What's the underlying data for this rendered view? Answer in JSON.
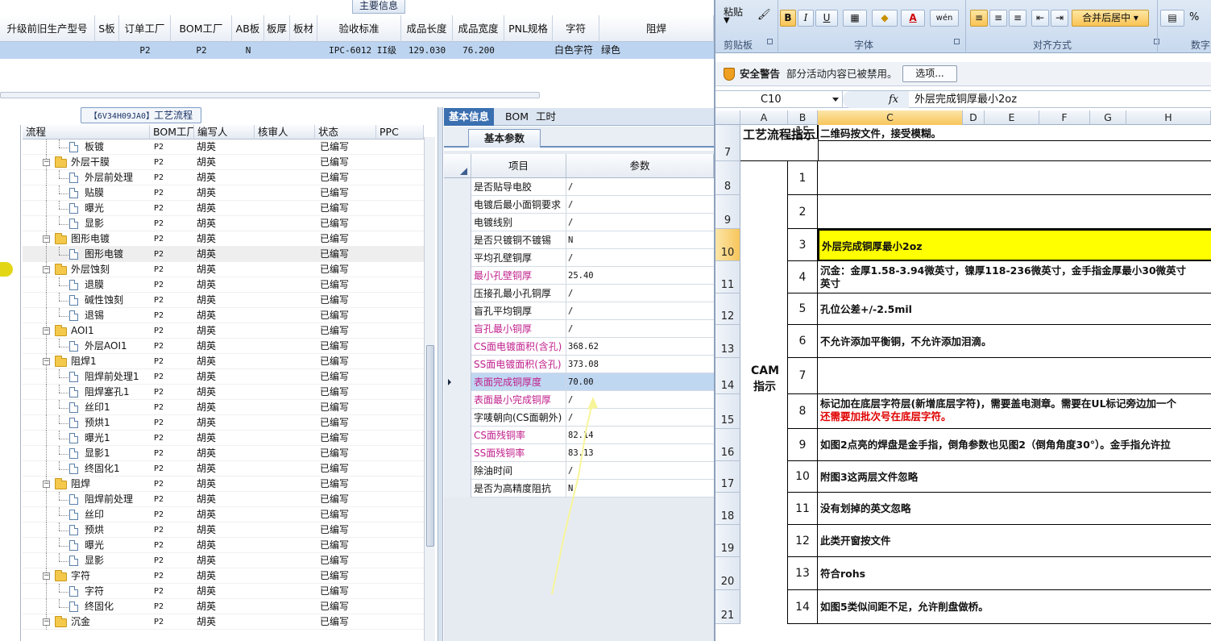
{
  "top_grid": {
    "tab_label": "主要信息",
    "columns": [
      "升级前旧生产型号",
      "S板",
      "订单工厂",
      "BOM工厂",
      "AB板",
      "板厚",
      "板材",
      "验收标准",
      "成品长度",
      "成品宽度",
      "PNL规格",
      "字符",
      "阻焊"
    ],
    "row": [
      "",
      "",
      "P2",
      "P2",
      "N",
      "",
      "",
      "IPC-6012 II级",
      "129.030",
      "76.200",
      "",
      "白色字符",
      "绿色"
    ]
  },
  "process": {
    "title_code": "【6V34H09JA0】",
    "title_text": "工艺流程",
    "columns": [
      "流程",
      "BOM工厂",
      "编写人",
      "核审人",
      "状态",
      "PPC"
    ],
    "rows": [
      {
        "name": "板镀",
        "folder": false,
        "bom": "P2",
        "author": "胡英",
        "status": "已编写"
      },
      {
        "name": "外层干膜",
        "folder": true,
        "bom": "P2",
        "author": "胡英",
        "status": "已编写"
      },
      {
        "name": "外层前处理",
        "folder": false,
        "bom": "P2",
        "author": "胡英",
        "status": "已编写"
      },
      {
        "name": "贴膜",
        "folder": false,
        "bom": "P2",
        "author": "胡英",
        "status": "已编写"
      },
      {
        "name": "曝光",
        "folder": false,
        "bom": "P2",
        "author": "胡英",
        "status": "已编写"
      },
      {
        "name": "显影",
        "folder": false,
        "bom": "P2",
        "author": "胡英",
        "status": "已编写"
      },
      {
        "name": "图形电镀",
        "folder": true,
        "bom": "P2",
        "author": "胡英",
        "status": "已编写"
      },
      {
        "name": "图形电镀",
        "folder": false,
        "bom": "P2",
        "author": "胡英",
        "status": "已编写",
        "selected": true
      },
      {
        "name": "外层蚀刻",
        "folder": true,
        "bom": "P2",
        "author": "胡英",
        "status": "已编写"
      },
      {
        "name": "退膜",
        "folder": false,
        "bom": "P2",
        "author": "胡英",
        "status": "已编写"
      },
      {
        "name": "碱性蚀刻",
        "folder": false,
        "bom": "P2",
        "author": "胡英",
        "status": "已编写"
      },
      {
        "name": "退锡",
        "folder": false,
        "bom": "P2",
        "author": "胡英",
        "status": "已编写"
      },
      {
        "name": "AOI1",
        "folder": true,
        "bom": "P2",
        "author": "胡英",
        "status": "已编写"
      },
      {
        "name": "外层AOI1",
        "folder": false,
        "bom": "P2",
        "author": "胡英",
        "status": "已编写"
      },
      {
        "name": "阻焊1",
        "folder": true,
        "bom": "P2",
        "author": "胡英",
        "status": "已编写"
      },
      {
        "name": "阻焊前处理1",
        "folder": false,
        "bom": "P2",
        "author": "胡英",
        "status": "已编写"
      },
      {
        "name": "阻焊塞孔1",
        "folder": false,
        "bom": "P2",
        "author": "胡英",
        "status": "已编写"
      },
      {
        "name": "丝印1",
        "folder": false,
        "bom": "P2",
        "author": "胡英",
        "status": "已编写"
      },
      {
        "name": "预烘1",
        "folder": false,
        "bom": "P2",
        "author": "胡英",
        "status": "已编写"
      },
      {
        "name": "曝光1",
        "folder": false,
        "bom": "P2",
        "author": "胡英",
        "status": "已编写"
      },
      {
        "name": "显影1",
        "folder": false,
        "bom": "P2",
        "author": "胡英",
        "status": "已编写"
      },
      {
        "name": "终固化1",
        "folder": false,
        "bom": "P2",
        "author": "胡英",
        "status": "已编写"
      },
      {
        "name": "阻焊",
        "folder": true,
        "bom": "P2",
        "author": "胡英",
        "status": "已编写"
      },
      {
        "name": "阻焊前处理",
        "folder": false,
        "bom": "P2",
        "author": "胡英",
        "status": "已编写"
      },
      {
        "name": "丝印",
        "folder": false,
        "bom": "P2",
        "author": "胡英",
        "status": "已编写"
      },
      {
        "name": "预烘",
        "folder": false,
        "bom": "P2",
        "author": "胡英",
        "status": "已编写"
      },
      {
        "name": "曝光",
        "folder": false,
        "bom": "P2",
        "author": "胡英",
        "status": "已编写"
      },
      {
        "name": "显影",
        "folder": false,
        "bom": "P2",
        "author": "胡英",
        "status": "已编写"
      },
      {
        "name": "字符",
        "folder": true,
        "bom": "P2",
        "author": "胡英",
        "status": "已编写"
      },
      {
        "name": "字符",
        "folder": false,
        "bom": "P2",
        "author": "胡英",
        "status": "已编写"
      },
      {
        "name": "终固化",
        "folder": false,
        "bom": "P2",
        "author": "胡英",
        "status": "已编写"
      },
      {
        "name": "沉金",
        "folder": true,
        "bom": "P2",
        "author": "胡英",
        "status": "已编写"
      }
    ]
  },
  "info": {
    "tabs": [
      "基本信息",
      "BOM",
      "工时"
    ],
    "subtab": "基本参数",
    "col_item": "项目",
    "col_param": "参数",
    "rows": [
      {
        "name": "是否贴导电胶",
        "value": "/",
        "pink": false
      },
      {
        "name": "电镀后最小面铜要求",
        "value": "/",
        "pink": false
      },
      {
        "name": "电镀线别",
        "value": "/",
        "pink": false
      },
      {
        "name": "是否只镀铜不镀锡",
        "value": "N",
        "pink": false
      },
      {
        "name": "平均孔壁铜厚",
        "value": "/",
        "pink": false
      },
      {
        "name": "最小孔壁铜厚",
        "value": "25.40",
        "pink": true
      },
      {
        "name": "压接孔最小孔铜厚",
        "value": "/",
        "pink": false
      },
      {
        "name": "盲孔平均铜厚",
        "value": "/",
        "pink": false
      },
      {
        "name": "盲孔最小铜厚",
        "value": "/",
        "pink": true
      },
      {
        "name": "CS面电镀面积(含孔)",
        "value": "368.62",
        "pink": true
      },
      {
        "name": "SS面电镀面积(含孔)",
        "value": "373.08",
        "pink": true
      },
      {
        "name": "表面完成铜厚度",
        "value": "70.00",
        "pink": true,
        "selected": true
      },
      {
        "name": "表面最小完成铜厚",
        "value": "/",
        "pink": true
      },
      {
        "name": "字唛朝向(CS面朝外)",
        "value": "/",
        "pink": false
      },
      {
        "name": "CS面残铜率",
        "value": "82.14",
        "pink": true
      },
      {
        "name": "SS面残铜率",
        "value": "83.13",
        "pink": true
      },
      {
        "name": "除油时间",
        "value": "/",
        "pink": false
      },
      {
        "name": "是否为高精度阻抗",
        "value": "N",
        "pink": false
      }
    ]
  },
  "excel": {
    "ribbon": {
      "paste_label": "粘贴",
      "clipboard_label": "剪贴板",
      "font_label": "字体",
      "align_label": "对齐方式",
      "number_label": "数字",
      "merge_label": "合并后居中",
      "bold": "B",
      "italic": "I",
      "underline": "U",
      "font_color_glyph": "A",
      "wen_glyph": "wén",
      "percent": "%"
    },
    "security": {
      "label": "安全警告",
      "text": "部分活动内容已被禁用。",
      "button": "选项..."
    },
    "namebox": "C10",
    "fx": "fx",
    "formula": "外层完成铜厚最小2oz",
    "columns": [
      "A",
      "B",
      "C",
      "D",
      "E",
      "F",
      "G",
      "H"
    ],
    "row_numbers": [
      "7",
      "8",
      "9",
      "10",
      "11",
      "12",
      "13",
      "14",
      "15",
      "16",
      "17",
      "18",
      "19",
      "20",
      "21"
    ],
    "title_cell": "工艺流程指示",
    "cam_cell": "CAM指示",
    "items": [
      {
        "no": "1",
        "text": ""
      },
      {
        "no": "2",
        "text": ""
      },
      {
        "no": "3",
        "text": "外层完成铜厚最小2oz",
        "yellow": true
      },
      {
        "no": "4",
        "text": "沉金：金厚1.58-3.94微英寸，镍厚118-236微英寸，金手指金厚最小30微英寸",
        "text2": "英寸"
      },
      {
        "no": "5",
        "text": "孔位公差+/-2.5mil"
      },
      {
        "no": "6",
        "text": "不允许添加平衡铜，不允许添加泪滴。"
      },
      {
        "no": "7",
        "text": ""
      },
      {
        "no": "8",
        "text": "标记加在底层字符层(新增底层字符)，需要盖电测章。需要在UL标记旁边加一个",
        "text2": "还需要加批次号在底层字符。",
        "red2": true
      },
      {
        "no": "9",
        "text": "如图2点亮的焊盘是金手指，倒角参数也见图2（倒角角度30°）。金手指允许拉"
      },
      {
        "no": "10",
        "text": "附图3这两层文件忽略"
      },
      {
        "no": "11",
        "text": "没有划掉的英文忽略"
      },
      {
        "no": "12",
        "text": "此类开窗按文件"
      },
      {
        "no": "13",
        "text": "符合rohs"
      },
      {
        "no": "14",
        "text": "如图5类似间距不足，允许削盘做桥。"
      },
      {
        "no": "15",
        "text": "二维码按文件，接受模糊。"
      }
    ]
  }
}
